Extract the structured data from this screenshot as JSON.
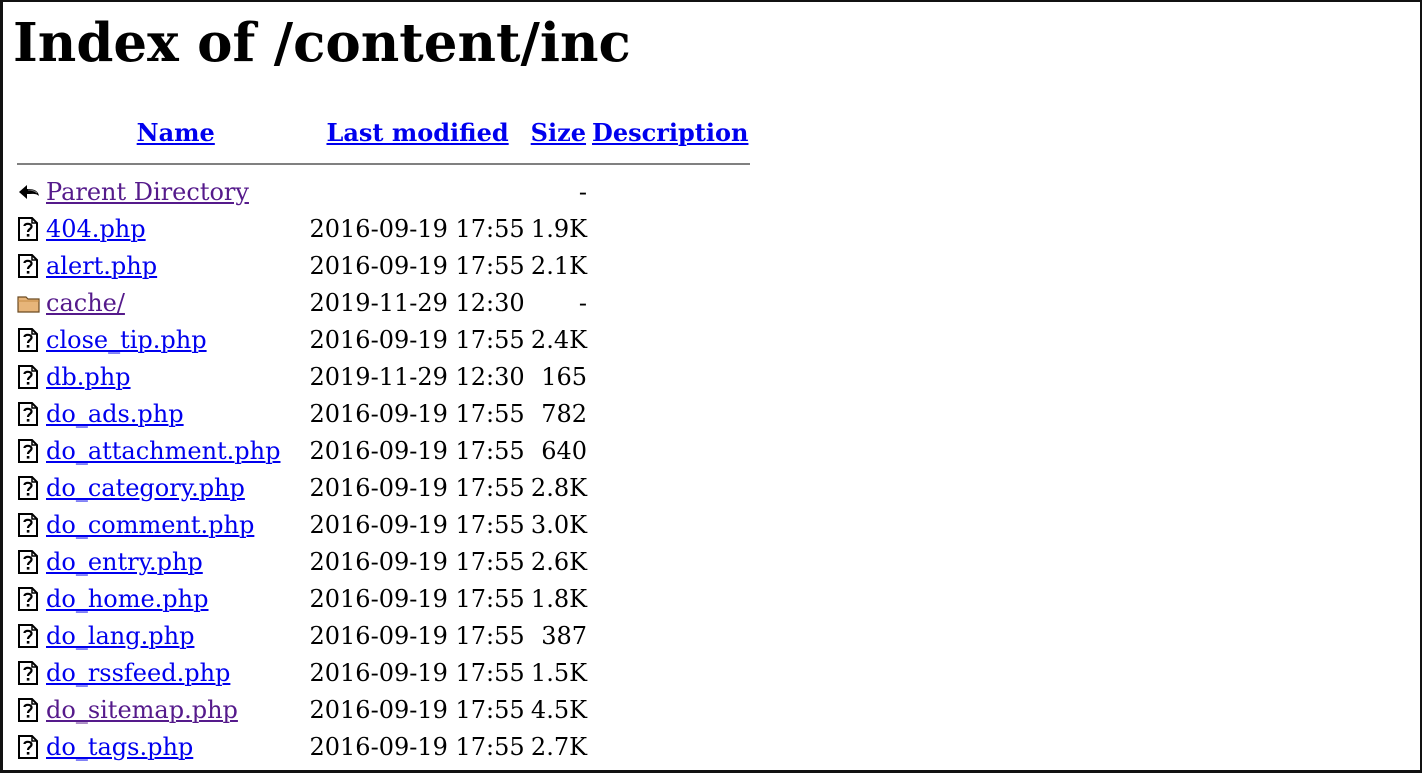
{
  "page": {
    "title": "Index of /content/inc",
    "link_color": "#0000ee",
    "visited_link_color": "#551a8b"
  },
  "columns": {
    "name": "Name",
    "last_modified": "Last modified",
    "size": "Size",
    "description": "Description"
  },
  "rows": [
    {
      "name": "Parent Directory",
      "date": "",
      "size": "-",
      "icon": "back-icon",
      "visited": true
    },
    {
      "name": "404.php",
      "date": "2016-09-19 17:55",
      "size": "1.9K",
      "icon": "unknown-file-icon",
      "visited": false
    },
    {
      "name": "alert.php",
      "date": "2016-09-19 17:55",
      "size": "2.1K",
      "icon": "unknown-file-icon",
      "visited": false
    },
    {
      "name": "cache/",
      "date": "2019-11-29 12:30",
      "size": "-",
      "icon": "folder-icon",
      "visited": true
    },
    {
      "name": "close_tip.php",
      "date": "2016-09-19 17:55",
      "size": "2.4K",
      "icon": "unknown-file-icon",
      "visited": false
    },
    {
      "name": "db.php",
      "date": "2019-11-29 12:30",
      "size": "165",
      "icon": "unknown-file-icon",
      "visited": false
    },
    {
      "name": "do_ads.php",
      "date": "2016-09-19 17:55",
      "size": "782",
      "icon": "unknown-file-icon",
      "visited": false
    },
    {
      "name": "do_attachment.php",
      "date": "2016-09-19 17:55",
      "size": "640",
      "icon": "unknown-file-icon",
      "visited": false
    },
    {
      "name": "do_category.php",
      "date": "2016-09-19 17:55",
      "size": "2.8K",
      "icon": "unknown-file-icon",
      "visited": false
    },
    {
      "name": "do_comment.php",
      "date": "2016-09-19 17:55",
      "size": "3.0K",
      "icon": "unknown-file-icon",
      "visited": false
    },
    {
      "name": "do_entry.php",
      "date": "2016-09-19 17:55",
      "size": "2.6K",
      "icon": "unknown-file-icon",
      "visited": false
    },
    {
      "name": "do_home.php",
      "date": "2016-09-19 17:55",
      "size": "1.8K",
      "icon": "unknown-file-icon",
      "visited": false
    },
    {
      "name": "do_lang.php",
      "date": "2016-09-19 17:55",
      "size": "387",
      "icon": "unknown-file-icon",
      "visited": false
    },
    {
      "name": "do_rssfeed.php",
      "date": "2016-09-19 17:55",
      "size": "1.5K",
      "icon": "unknown-file-icon",
      "visited": false
    },
    {
      "name": "do_sitemap.php",
      "date": "2016-09-19 17:55",
      "size": "4.5K",
      "icon": "unknown-file-icon",
      "visited": true
    },
    {
      "name": "do_tags.php",
      "date": "2016-09-19 17:55",
      "size": "2.7K",
      "icon": "unknown-file-icon",
      "visited": false
    }
  ]
}
